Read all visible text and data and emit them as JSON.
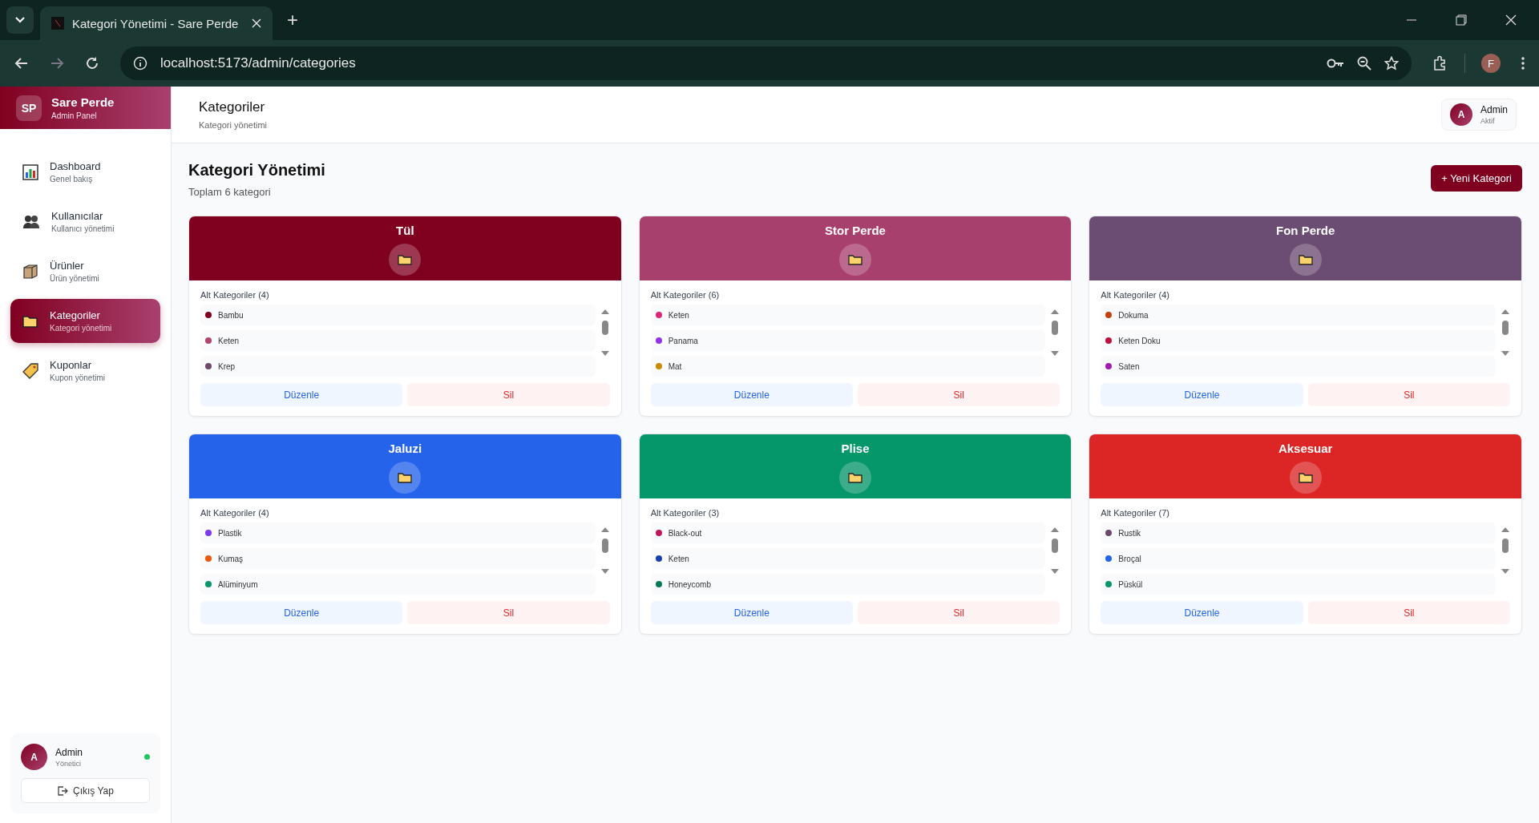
{
  "browser": {
    "tab_title": "Kategori Yönetimi - Sare Perde",
    "new_tab": "+",
    "url": "localhost:5173/admin/categories",
    "profile_initial": "F"
  },
  "sidebar": {
    "brand": {
      "logo": "SP",
      "title": "Sare Perde",
      "subtitle": "Admin Panel"
    },
    "items": [
      {
        "kind": "chart",
        "label": "Dashboard",
        "subtitle": "Genel bakış",
        "selected": false
      },
      {
        "kind": "users",
        "label": "Kullanıcılar",
        "subtitle": "Kullanıcı yönetimi",
        "selected": false
      },
      {
        "kind": "box",
        "label": "Ürünler",
        "subtitle": "Ürün yönetimi",
        "selected": false
      },
      {
        "kind": "folder",
        "label": "Kategoriler",
        "subtitle": "Kategori yönetimi",
        "selected": true
      },
      {
        "kind": "tag",
        "label": "Kuponlar",
        "subtitle": "Kupon yönetimi",
        "selected": false
      }
    ],
    "user": {
      "initial": "A",
      "name": "Admin",
      "role": "Yönetici",
      "online": true,
      "logout": "Çıkış Yap"
    }
  },
  "header": {
    "title": "Kategoriler",
    "subtitle": "Kategori yönetimi",
    "user": {
      "initial": "A",
      "name": "Admin",
      "status": "Aktif"
    }
  },
  "content": {
    "title": "Kategori Yönetimi",
    "summary": "Toplam 6 kategori",
    "new_button": "+ Yeni Kategori",
    "categories": [
      {
        "name": "Tül",
        "color": "#800020",
        "sub_label": "Alt Kategoriler (4)",
        "edit": "Düzenle",
        "delete": "Sil",
        "subcategories": [
          {
            "name": "Bambu",
            "color": "#800020"
          },
          {
            "name": "Keten",
            "color": "#b0446e"
          },
          {
            "name": "Krep",
            "color": "#6b4a6b"
          }
        ]
      },
      {
        "name": "Stor Perde",
        "color": "#a8406e",
        "sub_label": "Alt Kategoriler (6)",
        "edit": "Düzenle",
        "delete": "Sil",
        "subcategories": [
          {
            "name": "Keten",
            "color": "#db2777"
          },
          {
            "name": "Panama",
            "color": "#9333ea"
          },
          {
            "name": "Mat",
            "color": "#ca8a04"
          }
        ]
      },
      {
        "name": "Fon Perde",
        "color": "#6b4c72",
        "sub_label": "Alt Kategoriler (4)",
        "edit": "Düzenle",
        "delete": "Sil",
        "subcategories": [
          {
            "name": "Dokuma",
            "color": "#c2410c"
          },
          {
            "name": "Keten Doku",
            "color": "#be123c"
          },
          {
            "name": "Saten",
            "color": "#a21caf"
          }
        ]
      },
      {
        "name": "Jaluzi",
        "color": "#2563eb",
        "sub_label": "Alt Kategoriler (4)",
        "edit": "Düzenle",
        "delete": "Sil",
        "subcategories": [
          {
            "name": "Plastik",
            "color": "#7c3aed"
          },
          {
            "name": "Kumaş",
            "color": "#ea580c"
          },
          {
            "name": "Alüminyum",
            "color": "#059669"
          }
        ]
      },
      {
        "name": "Plise",
        "color": "#059669",
        "sub_label": "Alt Kategoriler (3)",
        "edit": "Düzenle",
        "delete": "Sil",
        "subcategories": [
          {
            "name": "Black-out",
            "color": "#be185d"
          },
          {
            "name": "Keten",
            "color": "#1e40af"
          },
          {
            "name": "Honeycomb",
            "color": "#047857"
          }
        ]
      },
      {
        "name": "Aksesuar",
        "color": "#dc2626",
        "sub_label": "Alt Kategoriler (7)",
        "edit": "Düzenle",
        "delete": "Sil",
        "subcategories": [
          {
            "name": "Rustik",
            "color": "#6b4a6b"
          },
          {
            "name": "Broçal",
            "color": "#2563eb"
          },
          {
            "name": "Püskül",
            "color": "#059669"
          }
        ]
      }
    ]
  }
}
